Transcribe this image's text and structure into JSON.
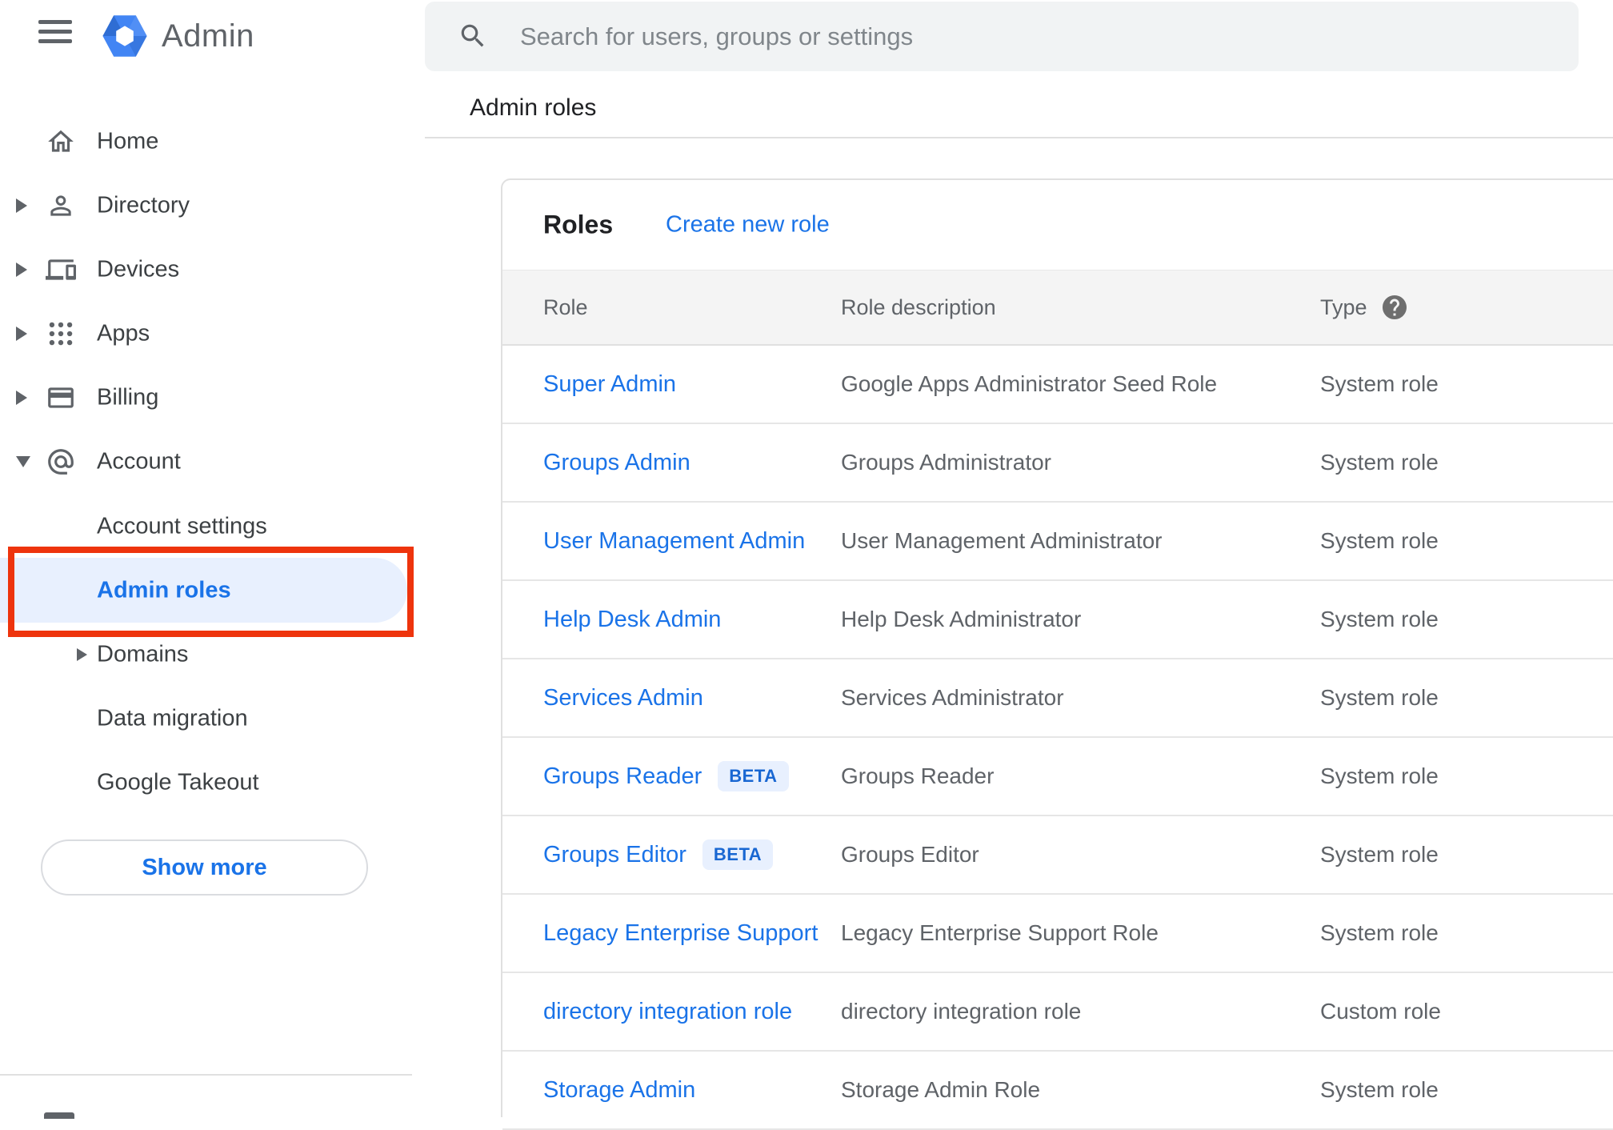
{
  "app": {
    "product_name": "Admin"
  },
  "search": {
    "placeholder": "Search for users, groups or settings"
  },
  "breadcrumb": "Admin roles",
  "sidebar": {
    "items": [
      {
        "label": "Home",
        "icon": "home",
        "arrow": "none",
        "indent": false,
        "selected": false
      },
      {
        "label": "Directory",
        "icon": "person",
        "arrow": "right",
        "indent": false,
        "selected": false
      },
      {
        "label": "Devices",
        "icon": "devices",
        "arrow": "right",
        "indent": false,
        "selected": false
      },
      {
        "label": "Apps",
        "icon": "apps",
        "arrow": "right",
        "indent": false,
        "selected": false
      },
      {
        "label": "Billing",
        "icon": "card",
        "arrow": "right",
        "indent": false,
        "selected": false
      },
      {
        "label": "Account",
        "icon": "at",
        "arrow": "down",
        "indent": false,
        "selected": false
      },
      {
        "label": "Account settings",
        "icon": null,
        "arrow": "none",
        "indent": true,
        "selected": false
      },
      {
        "label": "Admin roles",
        "icon": null,
        "arrow": "none",
        "indent": true,
        "selected": true
      },
      {
        "label": "Domains",
        "icon": null,
        "arrow": "sub-right",
        "indent": true,
        "selected": false
      },
      {
        "label": "Data migration",
        "icon": null,
        "arrow": "none",
        "indent": true,
        "selected": false
      },
      {
        "label": "Google Takeout",
        "icon": null,
        "arrow": "none",
        "indent": true,
        "selected": false
      }
    ],
    "show_more_label": "Show more"
  },
  "main": {
    "panel_title": "Roles",
    "create_link": "Create new role",
    "table": {
      "columns": [
        "Role",
        "Role description",
        "Type"
      ],
      "beta_label": "BETA",
      "rows": [
        {
          "role": "Super Admin",
          "beta": false,
          "description": "Google Apps Administrator Seed Role",
          "type": "System role"
        },
        {
          "role": "Groups Admin",
          "beta": false,
          "description": "Groups Administrator",
          "type": "System role"
        },
        {
          "role": "User Management Admin",
          "beta": false,
          "description": "User Management Administrator",
          "type": "System role"
        },
        {
          "role": "Help Desk Admin",
          "beta": false,
          "description": "Help Desk Administrator",
          "type": "System role"
        },
        {
          "role": "Services Admin",
          "beta": false,
          "description": "Services Administrator",
          "type": "System role"
        },
        {
          "role": "Groups Reader",
          "beta": true,
          "description": "Groups Reader",
          "type": "System role"
        },
        {
          "role": "Groups Editor",
          "beta": true,
          "description": "Groups Editor",
          "type": "System role"
        },
        {
          "role": "Legacy Enterprise Support",
          "beta": false,
          "description": "Legacy Enterprise Support Role",
          "type": "System role"
        },
        {
          "role": "directory integration role",
          "beta": false,
          "description": "directory integration role",
          "type": "Custom role"
        },
        {
          "role": "Storage Admin",
          "beta": false,
          "description": "Storage Admin Role",
          "type": "System role"
        }
      ]
    }
  },
  "colors": {
    "accent_blue": "#1a73e8",
    "selected_item_bg": "#e8f0fe",
    "annotation_red": "#ee340d",
    "beta_badge_bg": "#e8f0fe",
    "beta_badge_text": "#1967d2"
  }
}
